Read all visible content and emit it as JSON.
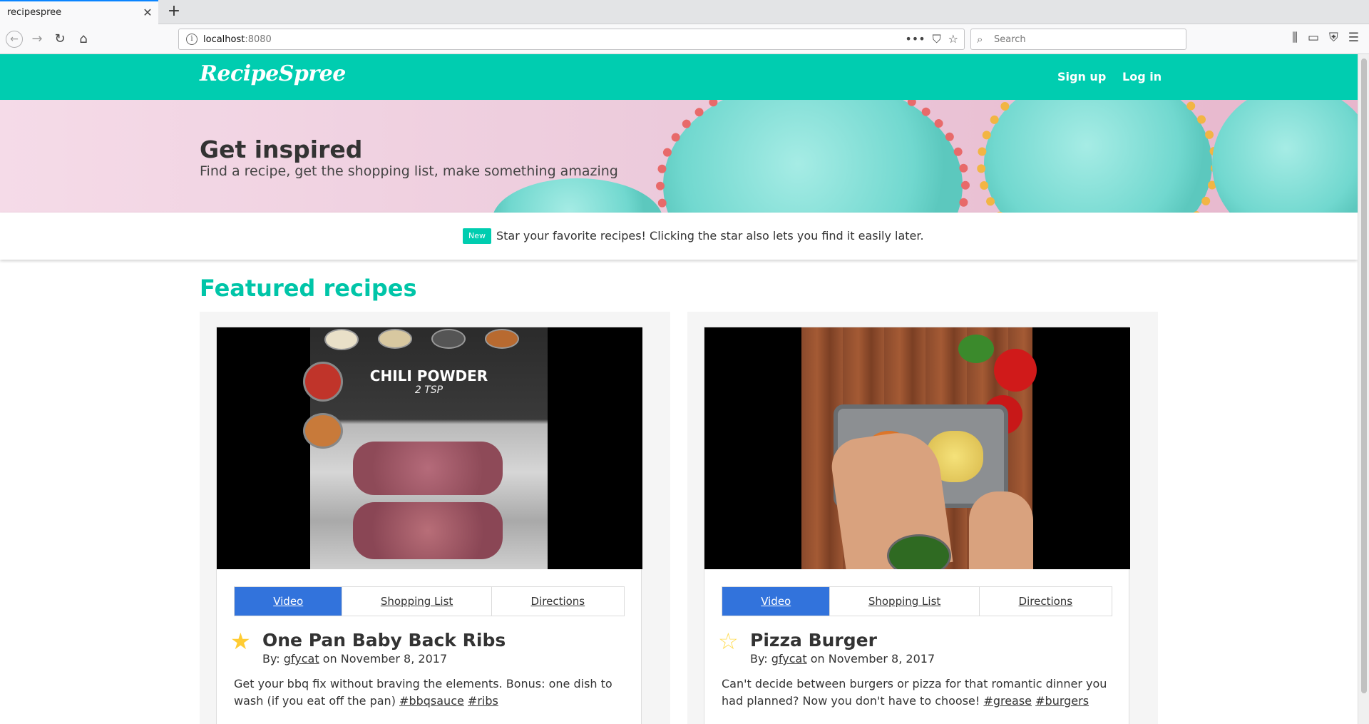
{
  "browser": {
    "tab_title": "recipespree",
    "url_host": "localhost",
    "url_port": ":8080",
    "search_placeholder": "Search"
  },
  "site": {
    "logo": "RecipeSpree",
    "nav": {
      "signup": "Sign up",
      "login": "Log in"
    },
    "accent_color": "#00cdb0"
  },
  "hero": {
    "title": "Get inspired",
    "subtitle": "Find a recipe, get the shopping list, make something amazing"
  },
  "notice": {
    "badge": "New",
    "text": "Star your favorite recipes! Clicking the star also lets you find it easily later."
  },
  "featured": {
    "heading": "Featured recipes",
    "recipes": [
      {
        "tabs": [
          "Video",
          "Shopping List",
          "Directions"
        ],
        "active_tab": "Video",
        "starred": true,
        "title": "One Pan Baby Back Ribs",
        "by_prefix": "By: ",
        "author": "gfycat",
        "date_text": " on November 8, 2017",
        "description": "Get your bbq fix without braving the elements. Bonus: one dish to wash (if you eat off the pan) ",
        "tags": [
          "#bbqsauce",
          "#ribs"
        ],
        "video_caption": "CHILI POWDER",
        "video_subcaption": "2 TSP"
      },
      {
        "tabs": [
          "Video",
          "Shopping List",
          "Directions"
        ],
        "active_tab": "Video",
        "starred": false,
        "title": "Pizza Burger",
        "by_prefix": "By: ",
        "author": "gfycat",
        "date_text": " on November 8, 2017",
        "description": "Can't decide between burgers or pizza for that romantic dinner you had planned? Now you don't have to choose! ",
        "tags": [
          "#grease",
          "#burgers"
        ]
      }
    ]
  }
}
